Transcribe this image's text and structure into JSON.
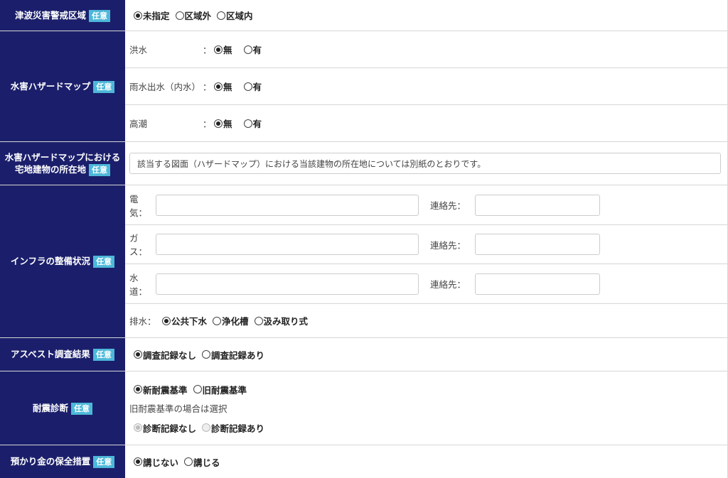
{
  "tsunami": {
    "label": "津波災害警戒区域",
    "badge": "任意",
    "options": [
      "未指定",
      "区域外",
      "区域内"
    ],
    "selected": 0
  },
  "flood_map": {
    "label": "水害ハザードマップ",
    "badge": "任意",
    "rows": [
      {
        "name": "洪水",
        "colon": "：",
        "options": [
          "無",
          "有"
        ],
        "selected": 0
      },
      {
        "name": "雨水出水（内水）",
        "colon": "：",
        "options": [
          "無",
          "有"
        ],
        "selected": 0
      },
      {
        "name": "高潮",
        "colon": "：",
        "options": [
          "無",
          "有"
        ],
        "selected": 0
      }
    ]
  },
  "flood_location": {
    "label_line1": "水害ハザードマップにおける",
    "label_line2": "宅地建物の所在地",
    "badge": "任意",
    "value": "該当する図面（ハザードマップ）における当該建物の所在地については別紙のとおりです。"
  },
  "infra": {
    "label": "インフラの整備状況",
    "badge": "任意",
    "contact_label": "連絡先：",
    "utilities": [
      {
        "name": "電気：",
        "value": "",
        "contact": ""
      },
      {
        "name": "ガス：",
        "value": "",
        "contact": ""
      },
      {
        "name": "水道：",
        "value": "",
        "contact": ""
      }
    ],
    "drain_label": "排水：",
    "drain_options": [
      "公共下水",
      "浄化槽",
      "汲み取り式"
    ],
    "drain_selected": 0
  },
  "asbestos": {
    "label": "アスベスト調査結果",
    "badge": "任意",
    "options": [
      "調査記録なし",
      "調査記録あり"
    ],
    "selected": 0
  },
  "seismic": {
    "label": "耐震診断",
    "badge": "任意",
    "options": [
      "新耐震基準",
      "旧耐震基準"
    ],
    "selected": 0,
    "note": "旧耐震基準の場合は選択",
    "sub_options": [
      "診断記録なし",
      "診断記録あり"
    ],
    "sub_selected": 0
  },
  "deposit": {
    "label": "預かり金の保全措置",
    "badge": "任意",
    "options": [
      "講じない",
      "講じる"
    ],
    "selected": 0
  }
}
